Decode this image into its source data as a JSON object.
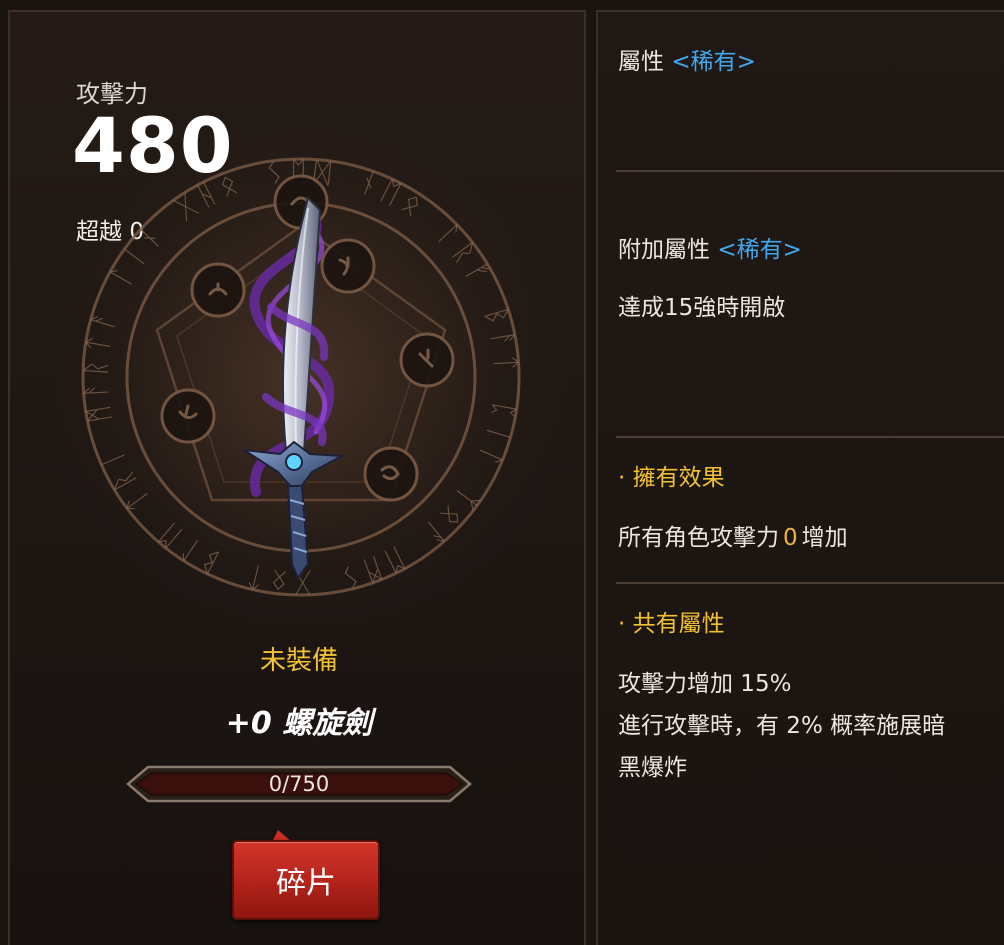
{
  "weapon": {
    "attack_label": "攻擊力",
    "attack_value": "480",
    "transcend_label": "超越",
    "transcend_value": "0",
    "equip_status": "未裝備",
    "name": "+0 螺旋劍",
    "progress": {
      "text": "0/750",
      "current": 0,
      "max": 750
    },
    "shard_button_label": "碎片"
  },
  "details": {
    "attribute": {
      "label": "屬性",
      "grade": "<稀有>"
    },
    "extra_attribute": {
      "label": "附加屬性",
      "grade": "<稀有>",
      "unlock_text": "達成15強時開啟"
    },
    "owned_effect": {
      "title": "· 擁有效果",
      "text_before": "所有角色攻擊力",
      "value": "0",
      "text_after": "增加"
    },
    "shared_attribute": {
      "title": "· 共有屬性",
      "line1": "攻擊力增加 15%",
      "line2": "進行攻擊時，有 2% 概率施展暗",
      "line3": "黑爆炸"
    }
  },
  "colors": {
    "rare": "#41a8f0",
    "gold": "#f2c230",
    "button_red": "#c92e24",
    "panel_border": "#3e2f25"
  },
  "icons": {
    "magic_circle": "magic-circle-emblem",
    "weapon": "spiral-sword-image"
  }
}
